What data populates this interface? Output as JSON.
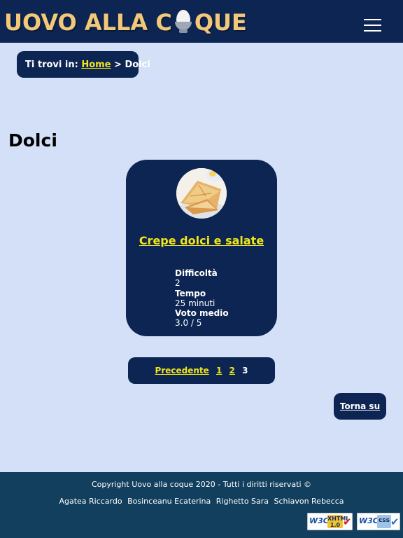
{
  "header": {
    "logo_part1": "UOVO ALLA C",
    "logo_part2": "QUE",
    "menu_icon": "hamburger-menu-icon"
  },
  "breadcrumb": {
    "prefix": "Ti trovi in:",
    "home_link": "Home",
    "separator": ">",
    "current": "Dolci"
  },
  "page": {
    "title": "Dolci"
  },
  "recipe": {
    "title": "Crepe dolci e salate",
    "difficulty_label": "Difficoltà",
    "difficulty_value": "2",
    "time_label": "Tempo",
    "time_value": "25 minuti",
    "rating_label": "Voto medio",
    "rating_value": "3.0 / 5"
  },
  "pagination": {
    "previous": "Precedente",
    "pages": [
      "1",
      "2"
    ],
    "current": "3"
  },
  "back_to_top": "Torna su",
  "footer": {
    "copyright": "Copyright Uovo alla coque 2020 - Tutti i diritti riservati ©",
    "authors": [
      "Agatea Riccardo",
      "Bosinceanu Ecaterina",
      "Righetto Sara",
      "Schiavon Rebecca"
    ],
    "badges": {
      "xhtml": {
        "org": "W3C",
        "line1": "XHTML",
        "line2": "1.0"
      },
      "css": {
        "org": "W3C",
        "line1": "css"
      }
    }
  },
  "colors": {
    "navy": "#0d2552",
    "link_yellow": "#f1e51b",
    "page_bg": "#d3e0f7",
    "footer_bg": "#123f5e",
    "logo": "#f2c87a"
  }
}
